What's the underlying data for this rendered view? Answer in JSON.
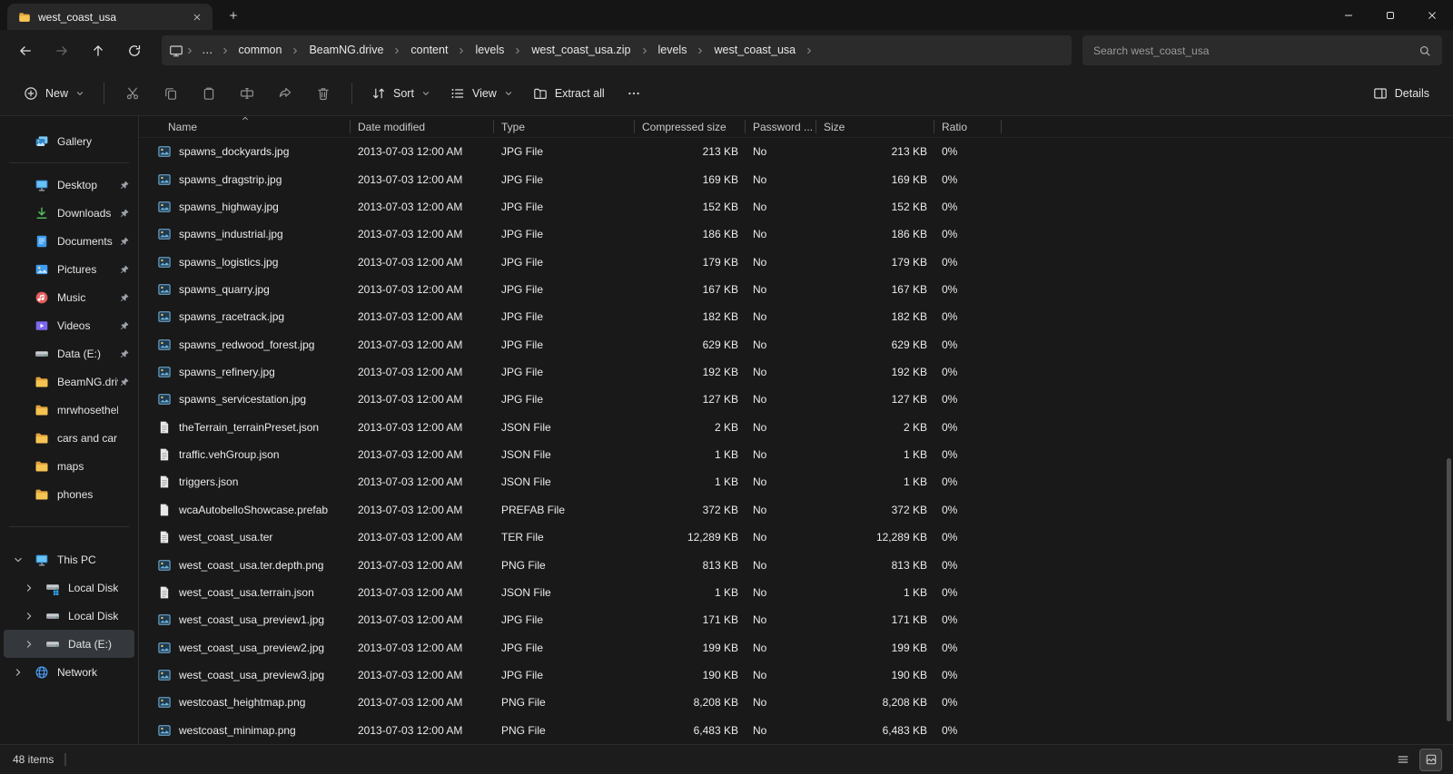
{
  "window": {
    "tab_title": "west_coast_usa"
  },
  "nav": {
    "overflow": "…",
    "crumbs": [
      "common",
      "BeamNG.drive",
      "content",
      "levels",
      "west_coast_usa.zip",
      "levels",
      "west_coast_usa"
    ],
    "search_placeholder": "Search west_coast_usa"
  },
  "toolbar": {
    "new_label": "New",
    "sort_label": "Sort",
    "view_label": "View",
    "extract_all_label": "Extract all",
    "details_label": "Details"
  },
  "sidebar": {
    "items": [
      {
        "label": "Gallery",
        "icon": "gallery"
      },
      {
        "type": "separator"
      },
      {
        "label": "Desktop",
        "icon": "desktop",
        "pinned": true
      },
      {
        "label": "Downloads",
        "icon": "downloads",
        "pinned": true
      },
      {
        "label": "Documents",
        "icon": "documents",
        "pinned": true
      },
      {
        "label": "Pictures",
        "icon": "pictures",
        "pinned": true
      },
      {
        "label": "Music",
        "icon": "music",
        "pinned": true
      },
      {
        "label": "Videos",
        "icon": "videos",
        "pinned": true
      },
      {
        "label": "Data (E:)",
        "icon": "drive",
        "pinned": true
      },
      {
        "label": "BeamNG.driv",
        "icon": "folder",
        "pinned": true
      },
      {
        "label": "mrwhosethebos",
        "icon": "folder"
      },
      {
        "label": "cars and car par",
        "icon": "folder"
      },
      {
        "label": "maps",
        "icon": "folder"
      },
      {
        "label": "phones",
        "icon": "folder"
      },
      {
        "type": "separator",
        "tall": true
      },
      {
        "label": "This PC",
        "icon": "thispc",
        "chevron": "down"
      },
      {
        "label": "Local Disk (C:)",
        "icon": "drive-win",
        "chevron": "right",
        "indent": 1
      },
      {
        "label": "Local Disk (D:)",
        "icon": "drive",
        "chevron": "right",
        "indent": 1
      },
      {
        "label": "Data (E:)",
        "icon": "drive",
        "chevron": "right",
        "indent": 1,
        "selected": true
      },
      {
        "label": "Network",
        "icon": "network",
        "chevron": "right"
      }
    ]
  },
  "filelist": {
    "columns": [
      {
        "key": "name",
        "label": "Name",
        "sorted": "ascending"
      },
      {
        "key": "date",
        "label": "Date modified"
      },
      {
        "key": "type",
        "label": "Type"
      },
      {
        "key": "compressed",
        "label": "Compressed size"
      },
      {
        "key": "password",
        "label": "Password ..."
      },
      {
        "key": "size",
        "label": "Size"
      },
      {
        "key": "ratio",
        "label": "Ratio"
      }
    ],
    "rows": [
      {
        "name": "spawns_dockyards.jpg",
        "date": "2013-07-03 12:00 AM",
        "type": "JPG File",
        "compressed": "213 KB",
        "password": "No",
        "size": "213 KB",
        "ratio": "0%",
        "icon": "img"
      },
      {
        "name": "spawns_dragstrip.jpg",
        "date": "2013-07-03 12:00 AM",
        "type": "JPG File",
        "compressed": "169 KB",
        "password": "No",
        "size": "169 KB",
        "ratio": "0%",
        "icon": "img"
      },
      {
        "name": "spawns_highway.jpg",
        "date": "2013-07-03 12:00 AM",
        "type": "JPG File",
        "compressed": "152 KB",
        "password": "No",
        "size": "152 KB",
        "ratio": "0%",
        "icon": "img"
      },
      {
        "name": "spawns_industrial.jpg",
        "date": "2013-07-03 12:00 AM",
        "type": "JPG File",
        "compressed": "186 KB",
        "password": "No",
        "size": "186 KB",
        "ratio": "0%",
        "icon": "img"
      },
      {
        "name": "spawns_logistics.jpg",
        "date": "2013-07-03 12:00 AM",
        "type": "JPG File",
        "compressed": "179 KB",
        "password": "No",
        "size": "179 KB",
        "ratio": "0%",
        "icon": "img"
      },
      {
        "name": "spawns_quarry.jpg",
        "date": "2013-07-03 12:00 AM",
        "type": "JPG File",
        "compressed": "167 KB",
        "password": "No",
        "size": "167 KB",
        "ratio": "0%",
        "icon": "img"
      },
      {
        "name": "spawns_racetrack.jpg",
        "date": "2013-07-03 12:00 AM",
        "type": "JPG File",
        "compressed": "182 KB",
        "password": "No",
        "size": "182 KB",
        "ratio": "0%",
        "icon": "img"
      },
      {
        "name": "spawns_redwood_forest.jpg",
        "date": "2013-07-03 12:00 AM",
        "type": "JPG File",
        "compressed": "629 KB",
        "password": "No",
        "size": "629 KB",
        "ratio": "0%",
        "icon": "img"
      },
      {
        "name": "spawns_refinery.jpg",
        "date": "2013-07-03 12:00 AM",
        "type": "JPG File",
        "compressed": "192 KB",
        "password": "No",
        "size": "192 KB",
        "ratio": "0%",
        "icon": "img"
      },
      {
        "name": "spawns_servicestation.jpg",
        "date": "2013-07-03 12:00 AM",
        "type": "JPG File",
        "compressed": "127 KB",
        "password": "No",
        "size": "127 KB",
        "ratio": "0%",
        "icon": "img"
      },
      {
        "name": "theTerrain_terrainPreset.json",
        "date": "2013-07-03 12:00 AM",
        "type": "JSON File",
        "compressed": "2 KB",
        "password": "No",
        "size": "2 KB",
        "ratio": "0%",
        "icon": "doc-lines"
      },
      {
        "name": "traffic.vehGroup.json",
        "date": "2013-07-03 12:00 AM",
        "type": "JSON File",
        "compressed": "1 KB",
        "password": "No",
        "size": "1 KB",
        "ratio": "0%",
        "icon": "doc-lines"
      },
      {
        "name": "triggers.json",
        "date": "2013-07-03 12:00 AM",
        "type": "JSON File",
        "compressed": "1 KB",
        "password": "No",
        "size": "1 KB",
        "ratio": "0%",
        "icon": "doc-lines"
      },
      {
        "name": "wcaAutobelloShowcase.prefab",
        "date": "2013-07-03 12:00 AM",
        "type": "PREFAB File",
        "compressed": "372 KB",
        "password": "No",
        "size": "372 KB",
        "ratio": "0%",
        "icon": "doc-plain"
      },
      {
        "name": "west_coast_usa.ter",
        "date": "2013-07-03 12:00 AM",
        "type": "TER File",
        "compressed": "12,289 KB",
        "password": "No",
        "size": "12,289 KB",
        "ratio": "0%",
        "icon": "doc-lines"
      },
      {
        "name": "west_coast_usa.ter.depth.png",
        "date": "2013-07-03 12:00 AM",
        "type": "PNG File",
        "compressed": "813 KB",
        "password": "No",
        "size": "813 KB",
        "ratio": "0%",
        "icon": "img"
      },
      {
        "name": "west_coast_usa.terrain.json",
        "date": "2013-07-03 12:00 AM",
        "type": "JSON File",
        "compressed": "1 KB",
        "password": "No",
        "size": "1 KB",
        "ratio": "0%",
        "icon": "doc-lines"
      },
      {
        "name": "west_coast_usa_preview1.jpg",
        "date": "2013-07-03 12:00 AM",
        "type": "JPG File",
        "compressed": "171 KB",
        "password": "No",
        "size": "171 KB",
        "ratio": "0%",
        "icon": "img"
      },
      {
        "name": "west_coast_usa_preview2.jpg",
        "date": "2013-07-03 12:00 AM",
        "type": "JPG File",
        "compressed": "199 KB",
        "password": "No",
        "size": "199 KB",
        "ratio": "0%",
        "icon": "img"
      },
      {
        "name": "west_coast_usa_preview3.jpg",
        "date": "2013-07-03 12:00 AM",
        "type": "JPG File",
        "compressed": "190 KB",
        "password": "No",
        "size": "190 KB",
        "ratio": "0%",
        "icon": "img"
      },
      {
        "name": "westcoast_heightmap.png",
        "date": "2013-07-03 12:00 AM",
        "type": "PNG File",
        "compressed": "8,208 KB",
        "password": "No",
        "size": "8,208 KB",
        "ratio": "0%",
        "icon": "img"
      },
      {
        "name": "westcoast_minimap.png",
        "date": "2013-07-03 12:00 AM",
        "type": "PNG File",
        "compressed": "6,483 KB",
        "password": "No",
        "size": "6,483 KB",
        "ratio": "0%",
        "icon": "img"
      }
    ]
  },
  "statusbar": {
    "item_count": "48 items"
  }
}
